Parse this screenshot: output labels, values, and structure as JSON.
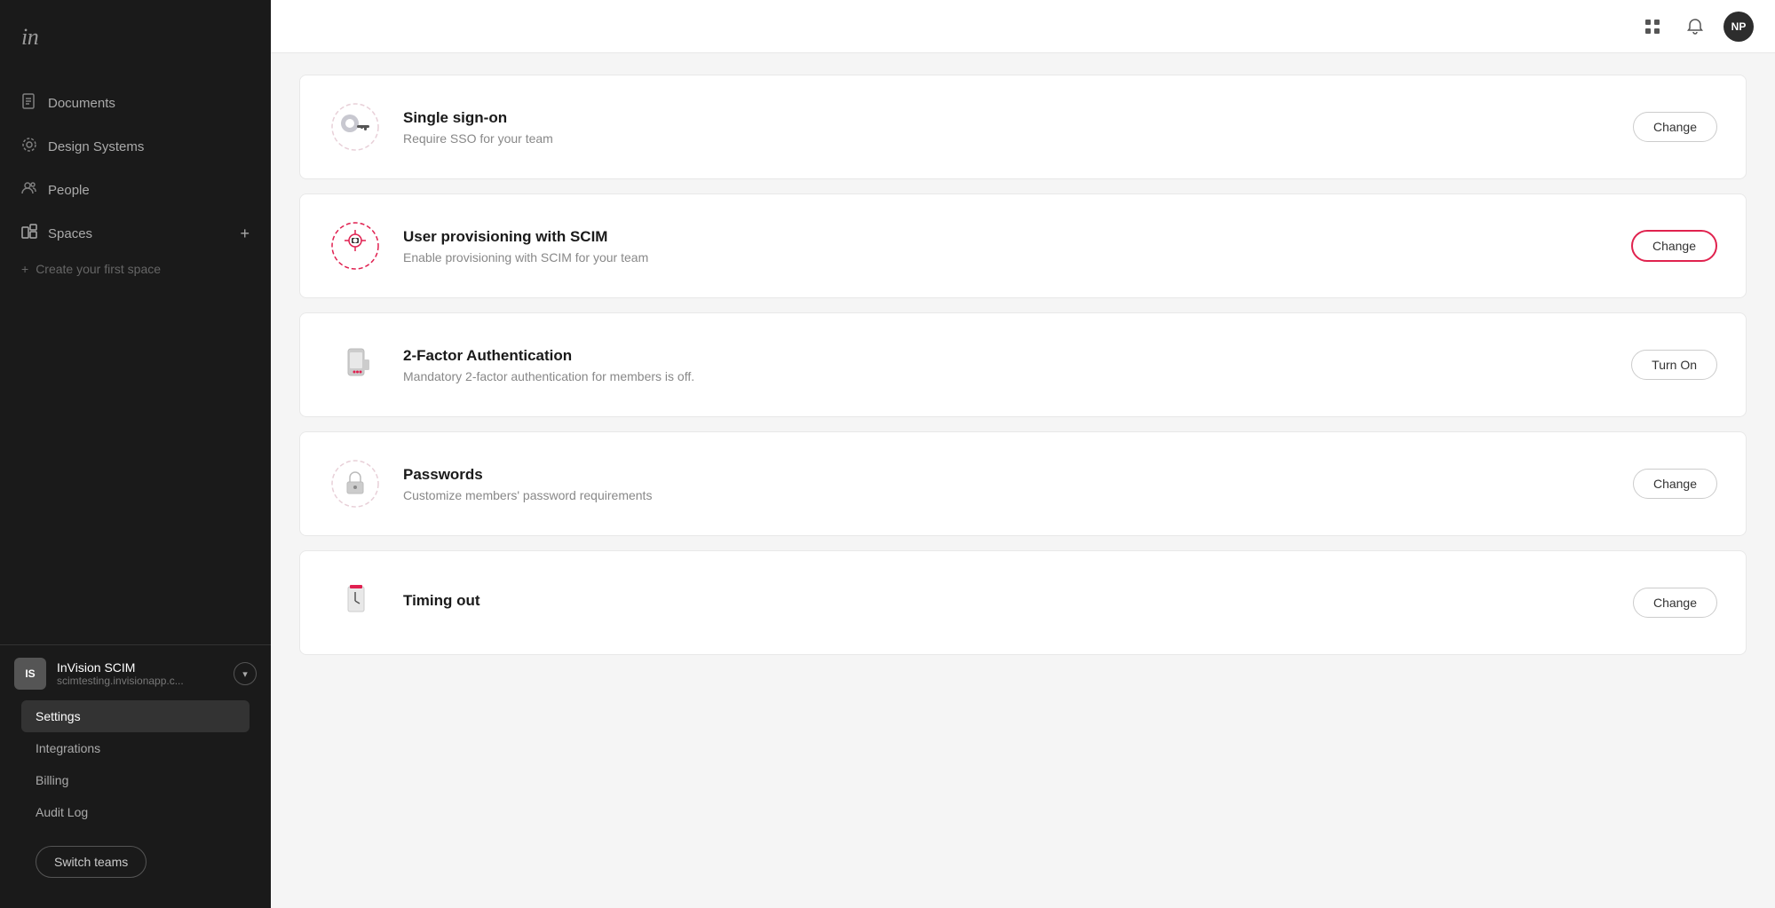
{
  "sidebar": {
    "logo": "in",
    "nav_items": [
      {
        "id": "documents",
        "label": "Documents",
        "icon": "📄"
      },
      {
        "id": "design-systems",
        "label": "Design Systems",
        "icon": "⚙"
      },
      {
        "id": "people",
        "label": "People",
        "icon": "👥"
      }
    ],
    "spaces_label": "Spaces",
    "create_space_label": "Create your first space",
    "team": {
      "initials": "IS",
      "name": "InVision SCIM",
      "url": "scimtesting.invisionapp.c..."
    },
    "menu_items": [
      {
        "id": "settings",
        "label": "Settings",
        "active": true
      },
      {
        "id": "integrations",
        "label": "Integrations",
        "active": false
      },
      {
        "id": "billing",
        "label": "Billing",
        "active": false
      },
      {
        "id": "audit-log",
        "label": "Audit Log",
        "active": false
      }
    ],
    "switch_teams_label": "Switch teams"
  },
  "topbar": {
    "grid_icon": "⊞",
    "bell_icon": "🔔",
    "avatar_initials": "NP"
  },
  "settings_cards": [
    {
      "id": "sso",
      "title": "Single sign-on",
      "description": "Require SSO for your team",
      "action_label": "Change",
      "action_type": "change",
      "highlighted": false
    },
    {
      "id": "scim",
      "title": "User provisioning with SCIM",
      "description": "Enable provisioning with SCIM for your team",
      "action_label": "Change",
      "action_type": "change",
      "highlighted": true
    },
    {
      "id": "2fa",
      "title": "2-Factor Authentication",
      "description": "Mandatory 2-factor authentication for members is off.",
      "action_label": "Turn On",
      "action_type": "turn-on",
      "highlighted": false
    },
    {
      "id": "passwords",
      "title": "Passwords",
      "description": "Customize members' password requirements",
      "action_label": "Change",
      "action_type": "change",
      "highlighted": false
    },
    {
      "id": "timing",
      "title": "Timing out",
      "description": "",
      "action_label": "Change",
      "action_type": "change",
      "highlighted": false
    }
  ]
}
